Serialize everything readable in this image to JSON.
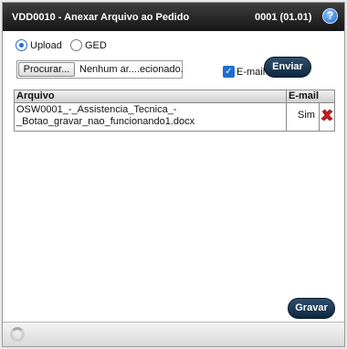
{
  "window": {
    "title": "VDD0010 - Anexar Arquivo ao Pedido",
    "code": "0001 (01.01)",
    "help_icon": "help-icon",
    "help_glyph": "?"
  },
  "source": {
    "upload_label": "Upload",
    "ged_label": "GED",
    "selected": "Upload"
  },
  "file": {
    "browse_label": "Procurar...",
    "filename": "Nenhum ar....ecionado."
  },
  "email_option": {
    "label": "E-mail",
    "checked": true
  },
  "buttons": {
    "send": "Enviar",
    "save": "Gravar"
  },
  "table": {
    "columns": [
      "Arquivo",
      "E-mail"
    ],
    "rows": [
      {
        "arquivo_line1": "OSW0001_-_Assistencia_Tecnica_-",
        "arquivo_line2": "_Botao_gravar_nao_funcionando1.docx",
        "email": "Sim",
        "action_icon": "delete-icon"
      }
    ]
  },
  "colors": {
    "titlebar": "#161616",
    "button": "#0f2740",
    "accent": "#1f6fd1",
    "delete": "#c81e1e"
  }
}
